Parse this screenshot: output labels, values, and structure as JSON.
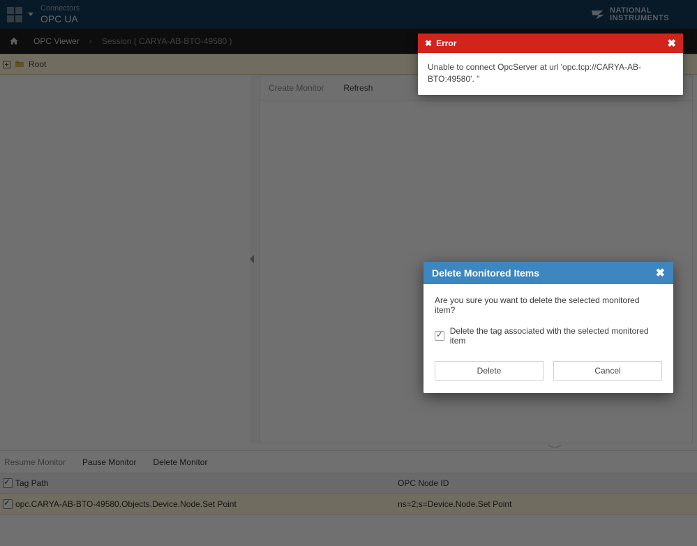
{
  "topbar": {
    "small": "Connectors",
    "big": "OPC UA",
    "ni_line1": "NATIONAL",
    "ni_line2": "INSTRUMENTS"
  },
  "breadcrumb": {
    "item1": "OPC Viewer",
    "item2": "Session ( CARYA-AB-BTO-49580 )"
  },
  "tree": {
    "root_label": "Root"
  },
  "right_toolbar": {
    "create": "Create Monitor",
    "refresh": "Refresh"
  },
  "bottom": {
    "resume": "Resume Monitor",
    "pause": "Pause Monitor",
    "del": "Delete Monitor"
  },
  "table": {
    "headers": {
      "c1": "Tag Path",
      "c2": "OPC Node ID"
    },
    "row": {
      "c1": "opc.CARYA-AB-BTO-49580.Objects.Device.Node.Set Point",
      "c2": "ns=2;s=Device.Node.Set Point"
    }
  },
  "toast": {
    "title": "Error",
    "message": "Unable to connect OpcServer at url 'opc.tcp://CARYA-AB-BTO:49580'. \""
  },
  "dialog": {
    "title": "Delete Monitored Items",
    "prompt": "Are you sure you want to delete the selected monitored item?",
    "checkbox": "Delete the tag associated with the selected monitored item",
    "btn_delete": "Delete",
    "btn_cancel": "Cancel"
  }
}
